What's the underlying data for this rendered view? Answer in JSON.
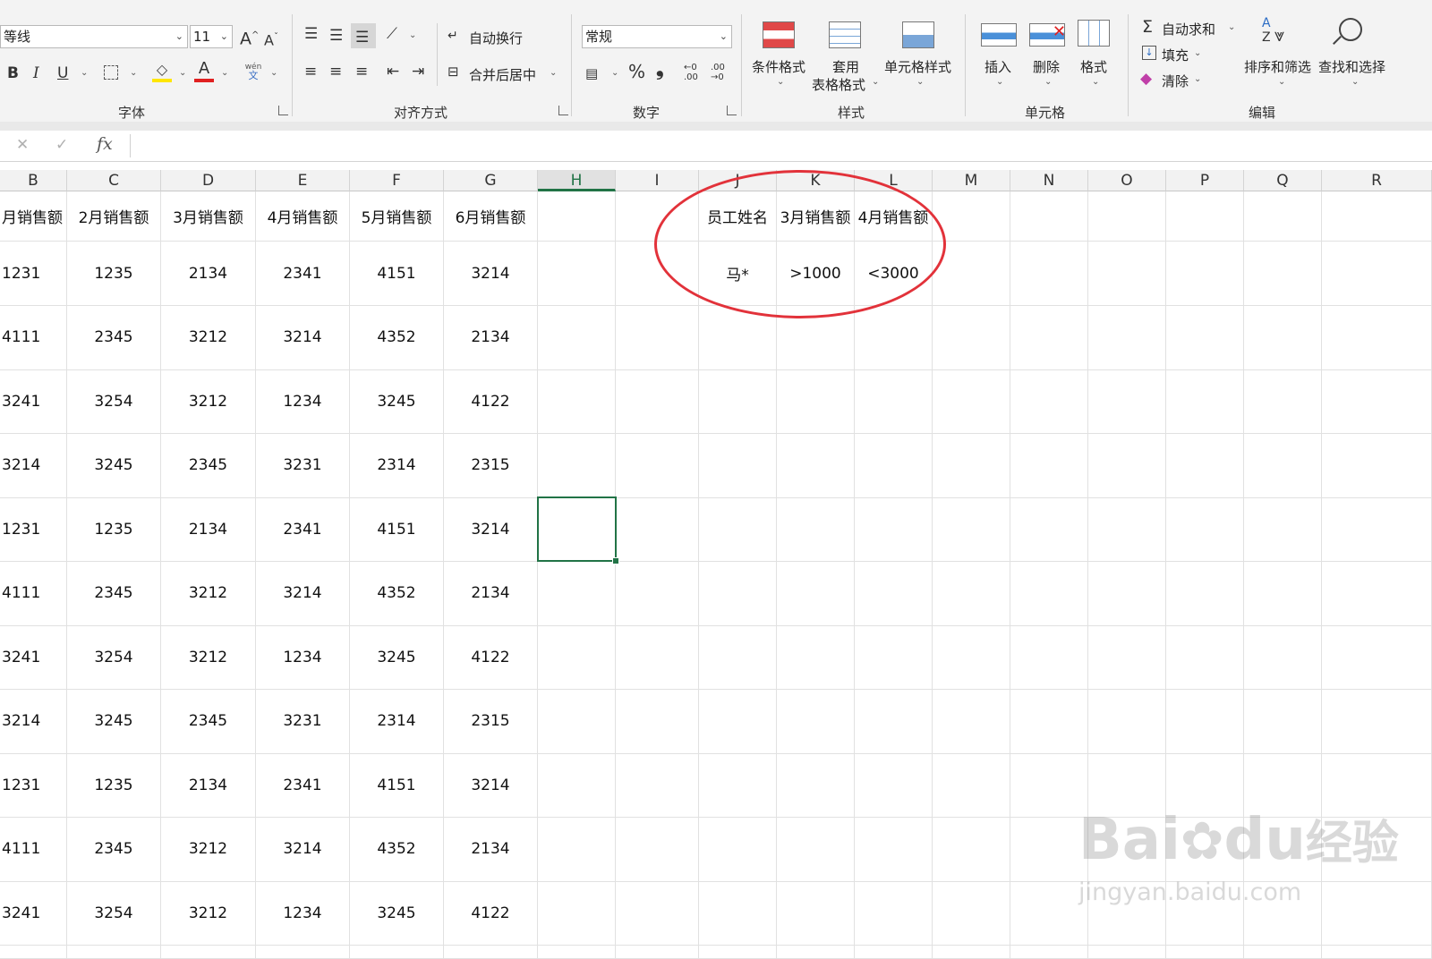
{
  "ribbon": {
    "font_name": "等线",
    "font_size": "11",
    "wrap_text": "自动换行",
    "merge_center": "合并后居中",
    "number_format": "常规",
    "conditional_format": "条件格式",
    "format_as_table_l1": "套用",
    "format_as_table_l2": "表格格式",
    "cell_styles": "单元格样式",
    "insert": "插入",
    "delete": "删除",
    "format": "格式",
    "autosum": "自动求和",
    "fill": "填充",
    "clear": "清除",
    "sort_filter": "排序和筛选",
    "find_select": "查找和选择",
    "groups": {
      "font": "字体",
      "alignment": "对齐方式",
      "number": "数字",
      "styles": "样式",
      "cells": "单元格",
      "editing": "编辑"
    },
    "bold": "B",
    "italic": "I",
    "underline": "U",
    "grow_font": "A",
    "shrink_font": "A",
    "percent": "%",
    "comma": "❟",
    "phonetic": "wén\n文"
  },
  "formula_bar": {
    "cancel": "✕",
    "enter": "✓",
    "fx": "fx",
    "content": ""
  },
  "columns": [
    "B",
    "C",
    "D",
    "E",
    "F",
    "G",
    "H",
    "I",
    "J",
    "K",
    "L",
    "M",
    "N",
    "O",
    "P",
    "Q",
    "R"
  ],
  "selected_column": "H",
  "header_row": [
    "月销售额",
    "2月销售额",
    "3月销售额",
    "4月销售额",
    "5月销售额",
    "6月销售额"
  ],
  "data_rows": [
    [
      "1231",
      "1235",
      "2134",
      "2341",
      "4151",
      "3214"
    ],
    [
      "4111",
      "2345",
      "3212",
      "3214",
      "4352",
      "2134"
    ],
    [
      "3241",
      "3254",
      "3212",
      "1234",
      "3245",
      "4122"
    ],
    [
      "3214",
      "3245",
      "2345",
      "3231",
      "2314",
      "2315"
    ],
    [
      "1231",
      "1235",
      "2134",
      "2341",
      "4151",
      "3214"
    ],
    [
      "4111",
      "2345",
      "3212",
      "3214",
      "4352",
      "2134"
    ],
    [
      "3241",
      "3254",
      "3212",
      "1234",
      "3245",
      "4122"
    ],
    [
      "3214",
      "3245",
      "2345",
      "3231",
      "2314",
      "2315"
    ],
    [
      "1231",
      "1235",
      "2134",
      "2341",
      "4151",
      "3214"
    ],
    [
      "4111",
      "2345",
      "3212",
      "3214",
      "4352",
      "2134"
    ],
    [
      "3241",
      "3254",
      "3212",
      "1234",
      "3245",
      "4122"
    ]
  ],
  "criteria": {
    "headers": [
      "员工姓名",
      "3月销售额",
      "4月销售额"
    ],
    "values": [
      "马*",
      ">1000",
      "<3000"
    ]
  },
  "colors": {
    "excel_green": "#217346",
    "annotation_red": "#e2323a",
    "highlight_yellow": "#ffe600",
    "font_red": "#e02020"
  },
  "watermark": {
    "brand": "Bai",
    "brand2": "du",
    "brand_cn": "经验",
    "url": "jingyan.baidu.com"
  }
}
